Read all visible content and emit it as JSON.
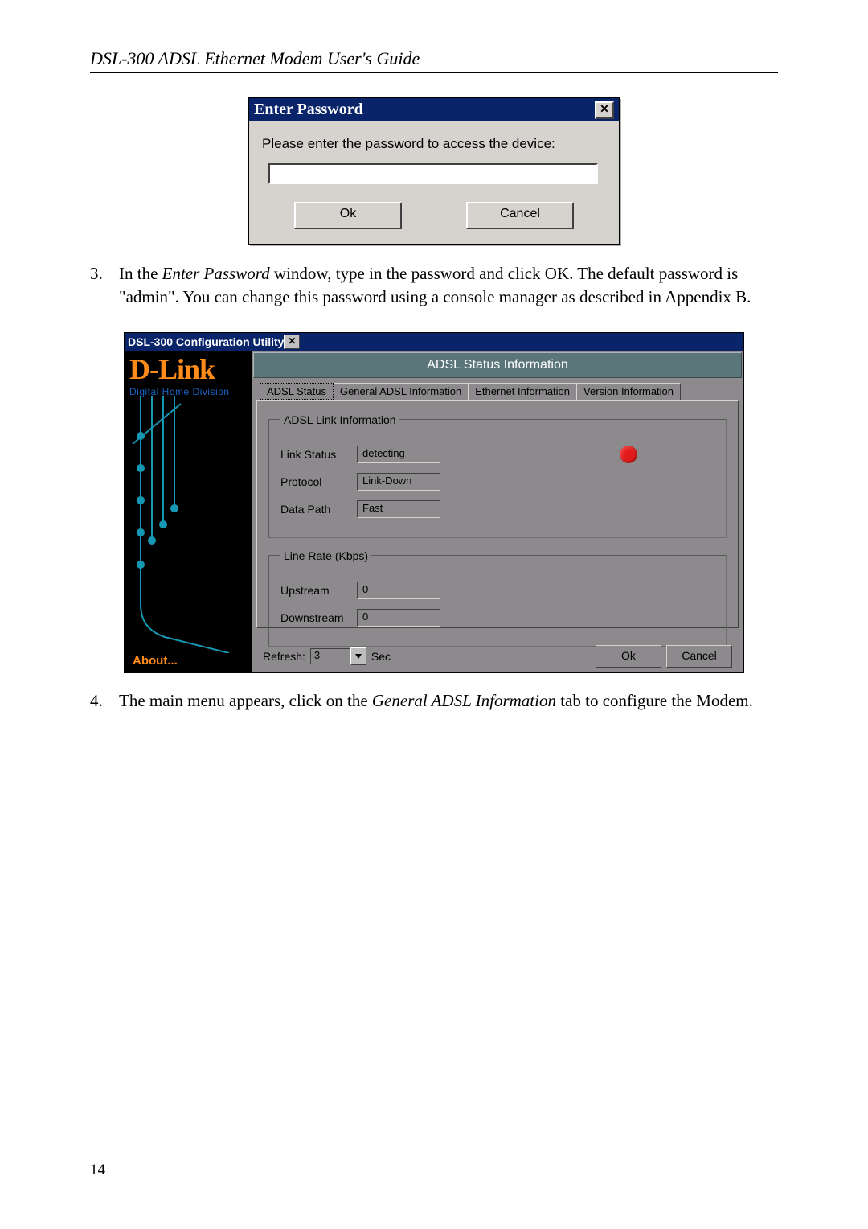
{
  "doc_header": "DSL-300 ADSL Ethernet Modem User's Guide",
  "page_number": "14",
  "password_dialog": {
    "title": "Enter Password",
    "close": "✕",
    "prompt": "Please enter the password to access the device:",
    "ok": "Ok",
    "cancel": "Cancel"
  },
  "step3": {
    "num": "3.",
    "prefix": "In the ",
    "em1": "Enter Password",
    "mid": " window, type in the password and click OK. The default password is \"admin\". You can change this password using a console manager as described in Appendix B."
  },
  "config_window": {
    "title": "DSL-300 Configuration Utility",
    "close": "✕",
    "logo": "D-Link",
    "logo_sub": "Digital  Home  Division",
    "about": "About...",
    "panel_title": "ADSL Status Information",
    "tabs": {
      "t1": "ADSL Status",
      "t2": "General ADSL Information",
      "t3": "Ethernet Information",
      "t4": "Version Information"
    },
    "group1": {
      "legend": "ADSL Link Information",
      "link_status_lbl": "Link Status",
      "protocol_lbl": "Protocol",
      "data_path_lbl": "Data Path",
      "link_status_val": "detecting",
      "protocol_val": "Link-Down",
      "data_path_val": "Fast"
    },
    "group2": {
      "legend": "Line Rate (Kbps)",
      "upstream_lbl": "Upstream",
      "downstream_lbl": "Downstream",
      "upstream_val": "0",
      "downstream_val": "0"
    },
    "refresh_lbl": "Refresh:",
    "refresh_val": "3",
    "refresh_unit": "Sec",
    "ok": "Ok",
    "cancel": "Cancel"
  },
  "step4": {
    "num": "4.",
    "prefix": "The main menu appears, click on the ",
    "em1": "General ADSL Information",
    "mid": " tab to configure the Modem."
  }
}
